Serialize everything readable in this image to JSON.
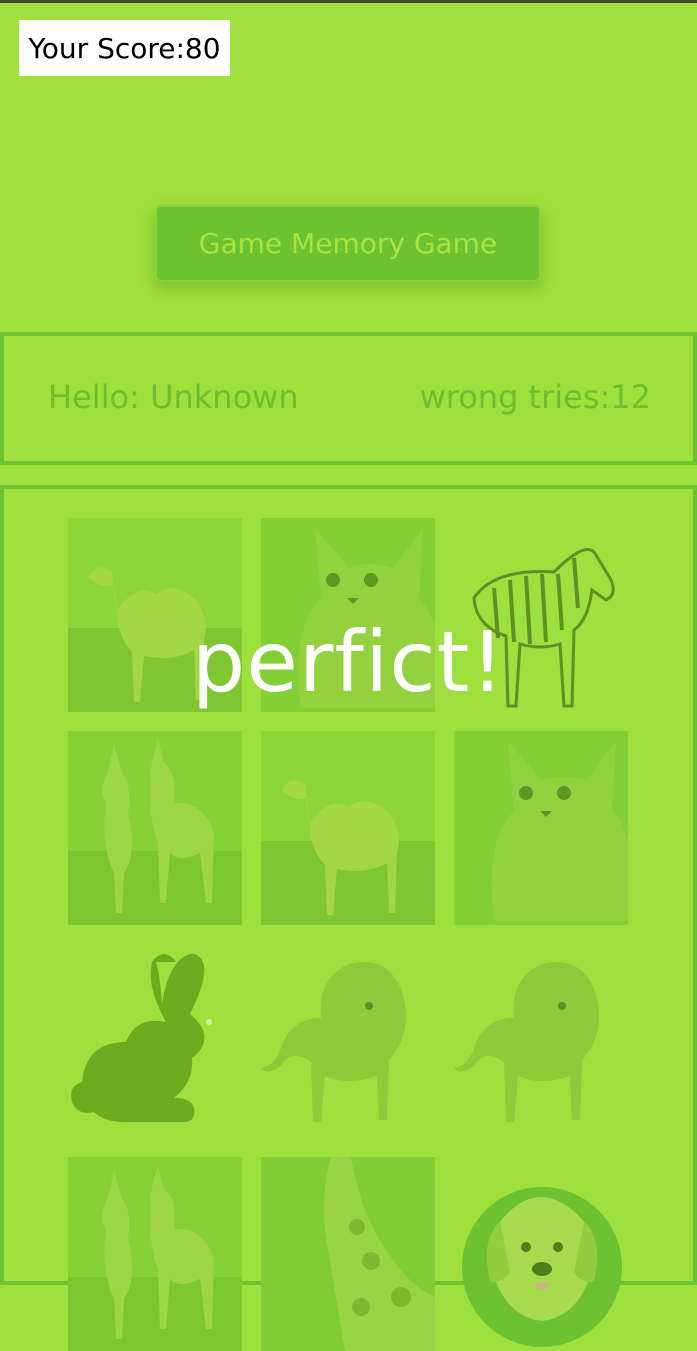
{
  "header": {
    "score_text": "Your Score:80",
    "title_button": "Game Memory Game"
  },
  "info": {
    "hello_text": "Hello: Unknown",
    "wrong_tries_text": "wrong tries:12"
  },
  "overlay": {
    "message": "perfict!"
  },
  "cards": [
    {
      "animal": "camel",
      "icon": "camel-icon"
    },
    {
      "animal": "kitten",
      "icon": "kitten-icon"
    },
    {
      "animal": "zebra",
      "icon": "zebra-icon"
    },
    {
      "animal": "donkeys",
      "icon": "donkey-icon"
    },
    {
      "animal": "camel",
      "icon": "camel-icon"
    },
    {
      "animal": "kitten",
      "icon": "kitten-icon"
    },
    {
      "animal": "rabbit",
      "icon": "rabbit-icon"
    },
    {
      "animal": "lion",
      "icon": "lion-icon"
    },
    {
      "animal": "lion",
      "icon": "lion-icon"
    },
    {
      "animal": "donkeys",
      "icon": "donkey-icon"
    },
    {
      "animal": "giraffe",
      "icon": "giraffe-icon"
    },
    {
      "animal": "puppy",
      "icon": "puppy-icon"
    }
  ],
  "colors": {
    "background": "#9ee03d",
    "border": "#6fc232",
    "button": "#6cc230",
    "text_dim": "#6fbe2f"
  }
}
